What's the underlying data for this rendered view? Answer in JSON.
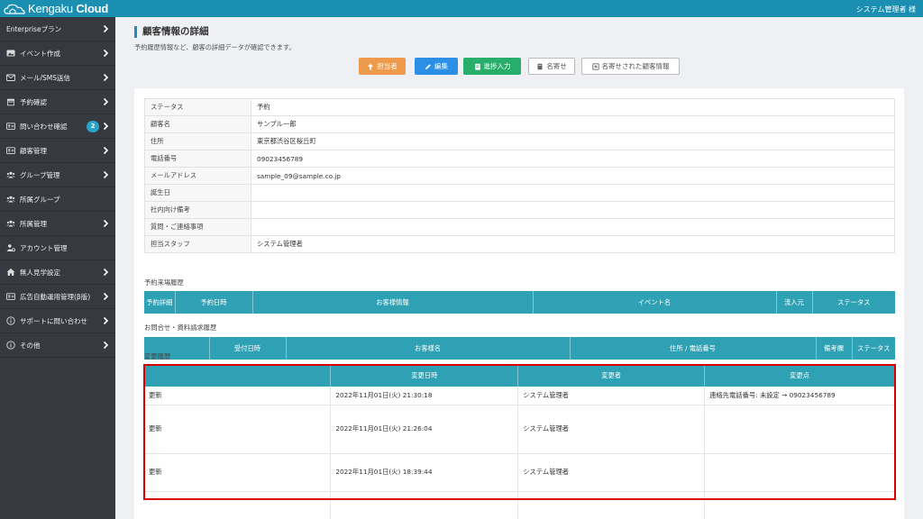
{
  "header": {
    "logo_prefix": "Kengaku",
    "logo_suffix": "Cloud",
    "user": "システム管理者 様"
  },
  "sidebar": {
    "items": [
      {
        "label": "Enterpriseプラン",
        "icon": "none",
        "arrow": true
      },
      {
        "label": "イベント作成",
        "icon": "image-icon",
        "arrow": true
      },
      {
        "label": "メール/SMS送信",
        "icon": "mail-icon",
        "arrow": true
      },
      {
        "label": "予約確認",
        "icon": "calendar-icon",
        "arrow": true
      },
      {
        "label": "問い合わせ確認",
        "icon": "id-card-icon",
        "arrow": true,
        "badge": "2"
      },
      {
        "label": "顧客管理",
        "icon": "id-card-icon",
        "arrow": true
      },
      {
        "label": "グループ管理",
        "icon": "users-icon",
        "arrow": true
      },
      {
        "label": "所属グループ",
        "icon": "users-icon",
        "arrow": false
      },
      {
        "label": "所属管理",
        "icon": "users-icon",
        "arrow": true
      },
      {
        "label": "アカウント管理",
        "icon": "user-gear-icon",
        "arrow": false
      },
      {
        "label": "無人見学設定",
        "icon": "home-icon",
        "arrow": true
      },
      {
        "label": "広告自動運用管理(β版)",
        "icon": "id-card-icon",
        "arrow": true
      },
      {
        "label": "サポートに問い合わせ",
        "icon": "info-icon",
        "arrow": true
      },
      {
        "label": "その他",
        "icon": "info-icon",
        "arrow": true
      }
    ]
  },
  "page": {
    "title": "顧客情報の詳細",
    "subtitle": "予約履歴情報など、顧客の詳細データが確認できます。",
    "buttons": {
      "assignee": "担当者",
      "edit": "編集",
      "progress": "進捗入力",
      "merge": "名寄せ",
      "merged": "名寄せされた顧客情報"
    }
  },
  "customer": {
    "rows": [
      {
        "key": "ステータス",
        "value": "予約"
      },
      {
        "key": "顧客名",
        "value": "サンプル一郎"
      },
      {
        "key": "住所",
        "value": "東京都渋谷区桜丘町"
      },
      {
        "key": "電話番号",
        "value": "09023456789"
      },
      {
        "key": "メールアドレス",
        "value": "sample_09@sample.co.jp"
      },
      {
        "key": "誕生日",
        "value": ""
      },
      {
        "key": "社内向け備考",
        "value": ""
      },
      {
        "key": "質問・ご連絡事項",
        "value": ""
      },
      {
        "key": "担当スタッフ",
        "value": "システム管理者"
      }
    ]
  },
  "reservations": {
    "label": "予約来場履歴",
    "headers": [
      "予約詳細",
      "予約日時",
      "お客様情報",
      "イベント名",
      "流入元",
      "ステータス"
    ]
  },
  "inquiries": {
    "label": "お問合せ・資料請求履歴",
    "headers": [
      "",
      "受付日時",
      "お客様名",
      "住所 / 電話番号",
      "備考欄",
      "ステータス"
    ]
  },
  "changes": {
    "label": "変更履歴",
    "headers": [
      "",
      "変更日時",
      "変更者",
      "変更点"
    ],
    "rows": [
      {
        "type": "更新",
        "datetime": "2022年11月01日(火) 21:30:18",
        "user": "システム管理者",
        "change": "連絡先電話番号: 未設定 → 09023456789"
      },
      {
        "type": "更新",
        "datetime": "2022年11月01日(火) 21:26:04",
        "user": "システム管理者",
        "change": ""
      },
      {
        "type": "更新",
        "datetime": "2022年11月01日(火) 18:39:44",
        "user": "システム管理者",
        "change": ""
      },
      {
        "type": "",
        "datetime": "",
        "user": "",
        "change": ""
      }
    ]
  },
  "colors": {
    "accent": "#1a8fb1",
    "table_header": "#2ea1b4",
    "sidebar": "#36393f",
    "highlight": "#d90000"
  }
}
